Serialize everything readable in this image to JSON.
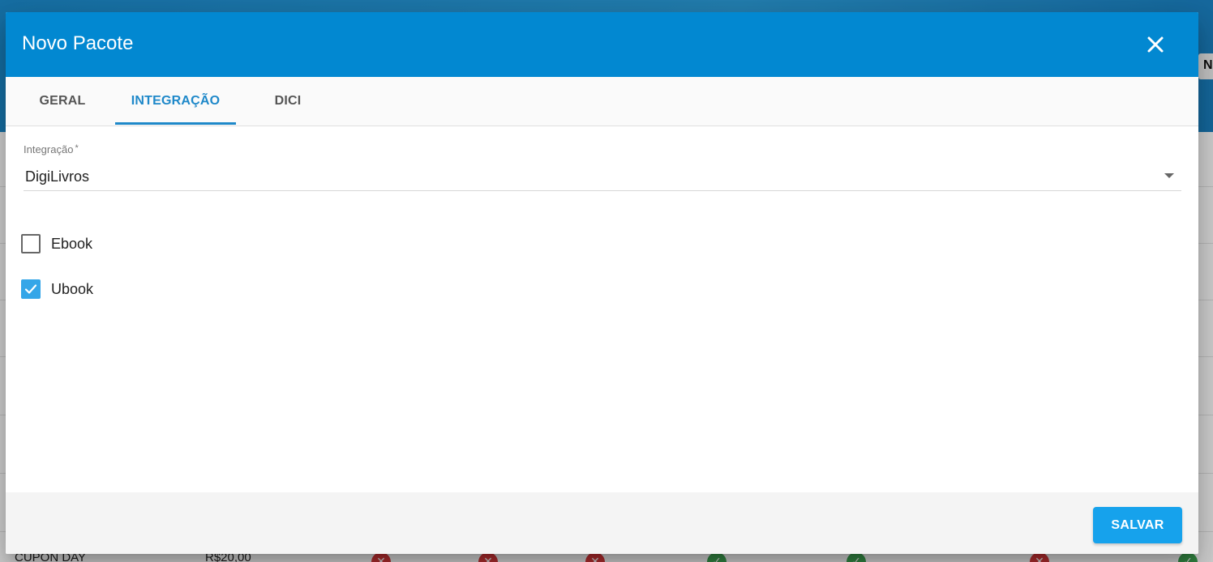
{
  "background": {
    "right_button_label": "N",
    "row": {
      "name": "CUPON DAY",
      "price": "R$20,00",
      "statuses": [
        "no",
        "no",
        "no",
        "yes",
        "yes",
        "no",
        "yes"
      ]
    },
    "colors": {
      "header": "#1c88c9",
      "status_no": "#d9383a",
      "status_yes": "#3fa552"
    }
  },
  "dialog": {
    "title": "Novo Pacote",
    "close_icon": "close-icon",
    "tabs": [
      {
        "label": "GERAL",
        "active": false
      },
      {
        "label": "INTEGRAÇÃO",
        "active": true
      },
      {
        "label": "DICI",
        "active": false
      }
    ],
    "integration_field": {
      "label": "Integração",
      "required_mark": "*",
      "value": "DigiLivros",
      "arrow_icon": "dropdown-arrow-icon"
    },
    "checkboxes": [
      {
        "label": "Ebook",
        "checked": false
      },
      {
        "label": "Ubook",
        "checked": true
      }
    ],
    "footer": {
      "save_label": "SALVAR"
    },
    "colors": {
      "header": "#0288d1",
      "accent": "#1e88c9",
      "checkbox": "#35a6e8",
      "save_button": "#16a2ec"
    }
  }
}
